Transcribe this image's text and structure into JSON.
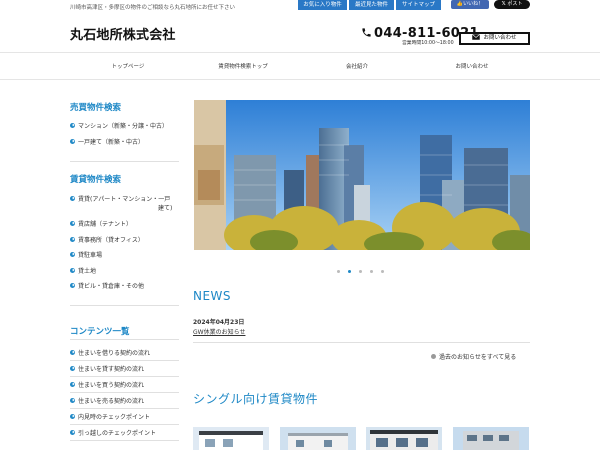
{
  "header": {
    "tagline": "川崎市高津区・多摩区の物件のご相談なら丸石地所にお任せ下さい",
    "site_title": "丸石地所株式会社",
    "tel": "044-811-6021",
    "hours": "営業時間10:00～18:00",
    "contact_button": "お問い合わせ",
    "top_links": [
      "お気に入り物件",
      "最近見た物件",
      "サイトマップ"
    ],
    "fb_like": "いいね！",
    "x_post": "ポスト",
    "icons": {
      "phone": "phone-icon",
      "mail": "mail-icon",
      "x": "x-logo-icon",
      "fb": "thumbs-up-icon"
    }
  },
  "nav": {
    "items": [
      "トップページ",
      "賃貸物件検索トップ",
      "会社紹介",
      "お問い合わせ"
    ]
  },
  "sidebar": {
    "sales": {
      "heading": "売買物件検索",
      "items": [
        "マンション（新築・分譲・中古）",
        "一戸建て（新築・中古）"
      ]
    },
    "rental": {
      "heading": "賃貸物件検索",
      "items": [
        "賃貸(アパート・マンション・一戸",
        "賃店舗（テナント）",
        "賃事務所（貸オフィス）",
        "貸駐車場",
        "貸土地",
        "貸ビル・貸倉庫・その他"
      ],
      "item0_cont": "建て)"
    },
    "contents": {
      "heading": "コンテンツ一覧",
      "items": [
        "住まいを借りる契約の流れ",
        "住まいを貸す契約の流れ",
        "住まいを買う契約の流れ",
        "住まいを売る契約の流れ",
        "内見時のチェックポイント",
        "引っ越しのチェックポイント"
      ]
    }
  },
  "slider": {
    "dot_count": 5,
    "active_index": 1
  },
  "news": {
    "title": "NEWS",
    "date": "2024年04月23日",
    "item": "GW休業のお知らせ",
    "all_link": "過去のお知らせをすべて見る"
  },
  "single_section": {
    "title": "シングル向け賃貸物件"
  },
  "colors": {
    "accent": "#1e88c6",
    "toplink_bg": "#2a78c6",
    "fb": "#4267b2"
  }
}
